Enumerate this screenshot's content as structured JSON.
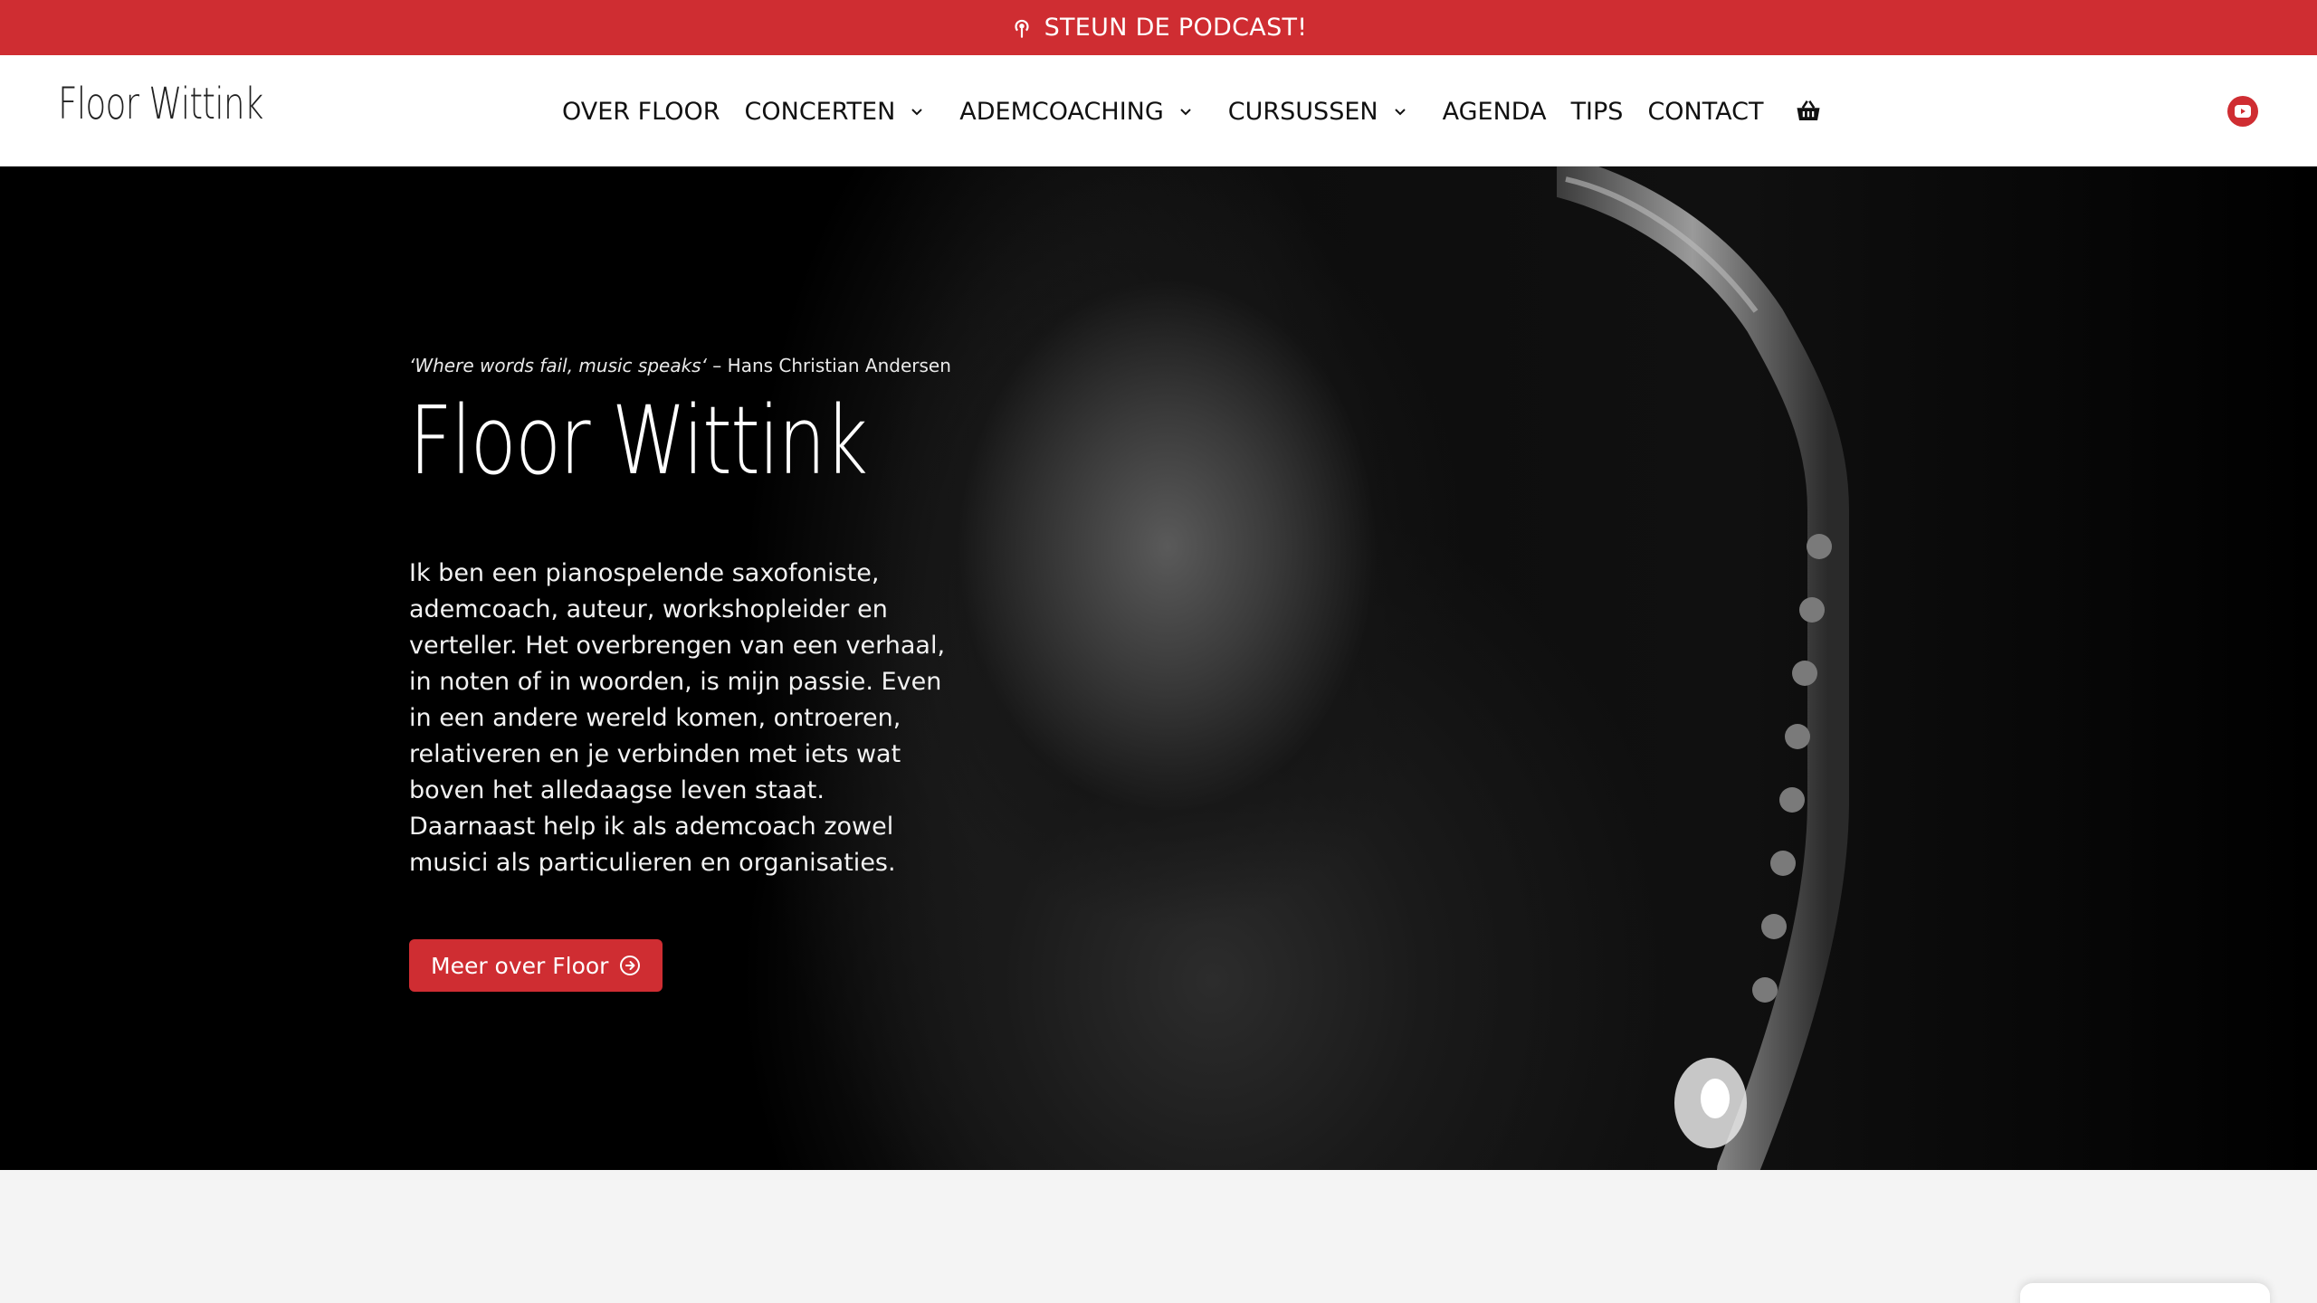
{
  "topbar": {
    "label": "STEUN DE PODCAST!",
    "icon": "podcast-icon"
  },
  "header": {
    "logo": "Floor Wittink",
    "nav": [
      {
        "label": "OVER FLOOR",
        "has_submenu": false
      },
      {
        "label": "CONCERTEN",
        "has_submenu": true
      },
      {
        "label": "ADEMCOACHING",
        "has_submenu": true
      },
      {
        "label": "CURSUSSEN",
        "has_submenu": true
      },
      {
        "label": "AGENDA",
        "has_submenu": false
      },
      {
        "label": "TIPS",
        "has_submenu": false
      },
      {
        "label": "CONTACT",
        "has_submenu": false
      }
    ],
    "cart_icon": "basket-icon",
    "social_icon": "youtube-icon"
  },
  "hero": {
    "quote_text": "‘Where words fail, music speaks‘",
    "quote_author": " – Hans Christian Andersen",
    "title": "Floor Wittink",
    "paragraph_1": "Ik ben een pianospelende saxofoniste, ademcoach, auteur, workshopleider en verteller. Het overbrengen van een verhaal, in noten of in woorden, is mijn passie. Even in een andere wereld komen, ontroeren, relativeren en je verbinden met iets wat boven het alledaagse leven staat.",
    "paragraph_2": "Daarnaast help ik als ademcoach zowel musici als particulieren en organisaties.",
    "button_label": "Meer over Floor",
    "button_icon": "arrow-circle-right-icon"
  },
  "colors": {
    "accent": "#cf2d32",
    "hero_bg": "#000000",
    "section_bg": "#f4f4f4"
  }
}
